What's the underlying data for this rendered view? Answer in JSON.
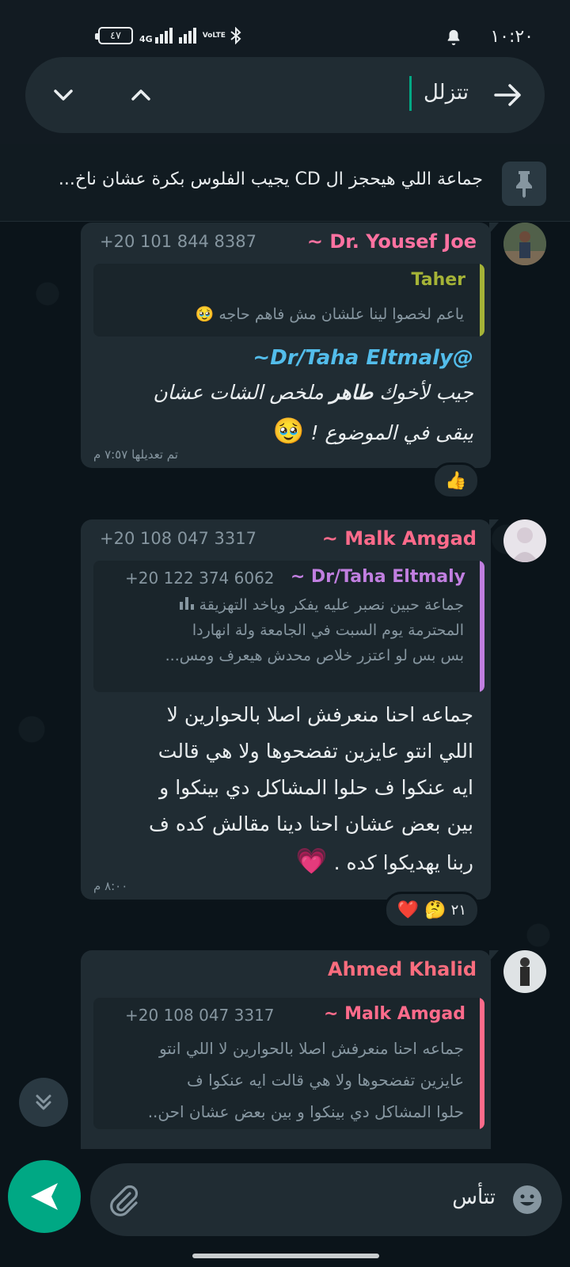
{
  "status_bar": {
    "time": "١٠:٢٠",
    "battery": "٤٧",
    "network": "4G",
    "volte": "VoLTE"
  },
  "search": {
    "value": "تتزلل"
  },
  "pinned": {
    "text": "جماعة اللي هيحجز ال CD يجيب الفلوس بكرة عشان ناخ..."
  },
  "messages": [
    {
      "sender": "~ Dr. Yousef Joe",
      "sender_color": "#ff72a1",
      "phone": "+20 101 844 8387",
      "quote": {
        "name": "Taher",
        "name_color": "#a5b337",
        "text": "ياعم لخصوا لينا علشان مش فاهم حاجه"
      },
      "mention": "~Dr/Taha Eltmaly@",
      "body_line1_before": "جيب لأخوك ",
      "body_bold": "طاهر",
      "body_line1_after": " ملخص الشات عشان",
      "body_line2": "يبقى في الموضوع !",
      "time": "تم تعديلها ٧:٥٧ م",
      "reaction": "👍"
    },
    {
      "sender": "~ Malk Amgad",
      "sender_color": "#ff6b8b",
      "phone": "+20 108 047 3317",
      "quote": {
        "name": "~ Dr/Taha Eltmaly",
        "name_color": "#c17fe0",
        "phone": "+20 122 374 6062",
        "line1": "جماعة حبين نصبر عليه يفكر وياخد التهزيقة",
        "line2": "المحترمة يوم السبت في الجامعة ولة انهاردا",
        "line3": "بس بس لو اعتزر خلاص محدش هيعرف ومس..."
      },
      "body_lines": [
        "جماعه احنا منعرفش اصلا بالحوارين لا",
        "اللي انتو عايزين تفضحوها ولا هي قالت",
        "ايه عنكوا ف حلوا المشاكل دي بينكوا و",
        "بين بعض عشان احنا دينا مقالش كده ف",
        "ربنا يهديكوا كده ."
      ],
      "time": "٨:٠٠ م",
      "reactions": "❤️ 🤔",
      "reaction_count": "٢١"
    },
    {
      "sender": "Ahmed Khalid",
      "sender_color": "#fa6d7e",
      "quote": {
        "name": "~ Malk Amgad",
        "name_color": "#ff6b8b",
        "phone": "+20 108 047 3317",
        "line1": "جماعه احنا منعرفش اصلا بالحوارين لا اللي انتو",
        "line2": "عايزين تفضحوها ولا هي قالت ايه عنكوا ف",
        "line3": "حلوا المشاكل دي بينكوا و بين بعض عشان احن.."
      }
    }
  ],
  "composer": {
    "value": "تتأس"
  },
  "colors": {
    "accent": "#00a884",
    "bubble": "#202c33",
    "background": "#0b141a"
  }
}
